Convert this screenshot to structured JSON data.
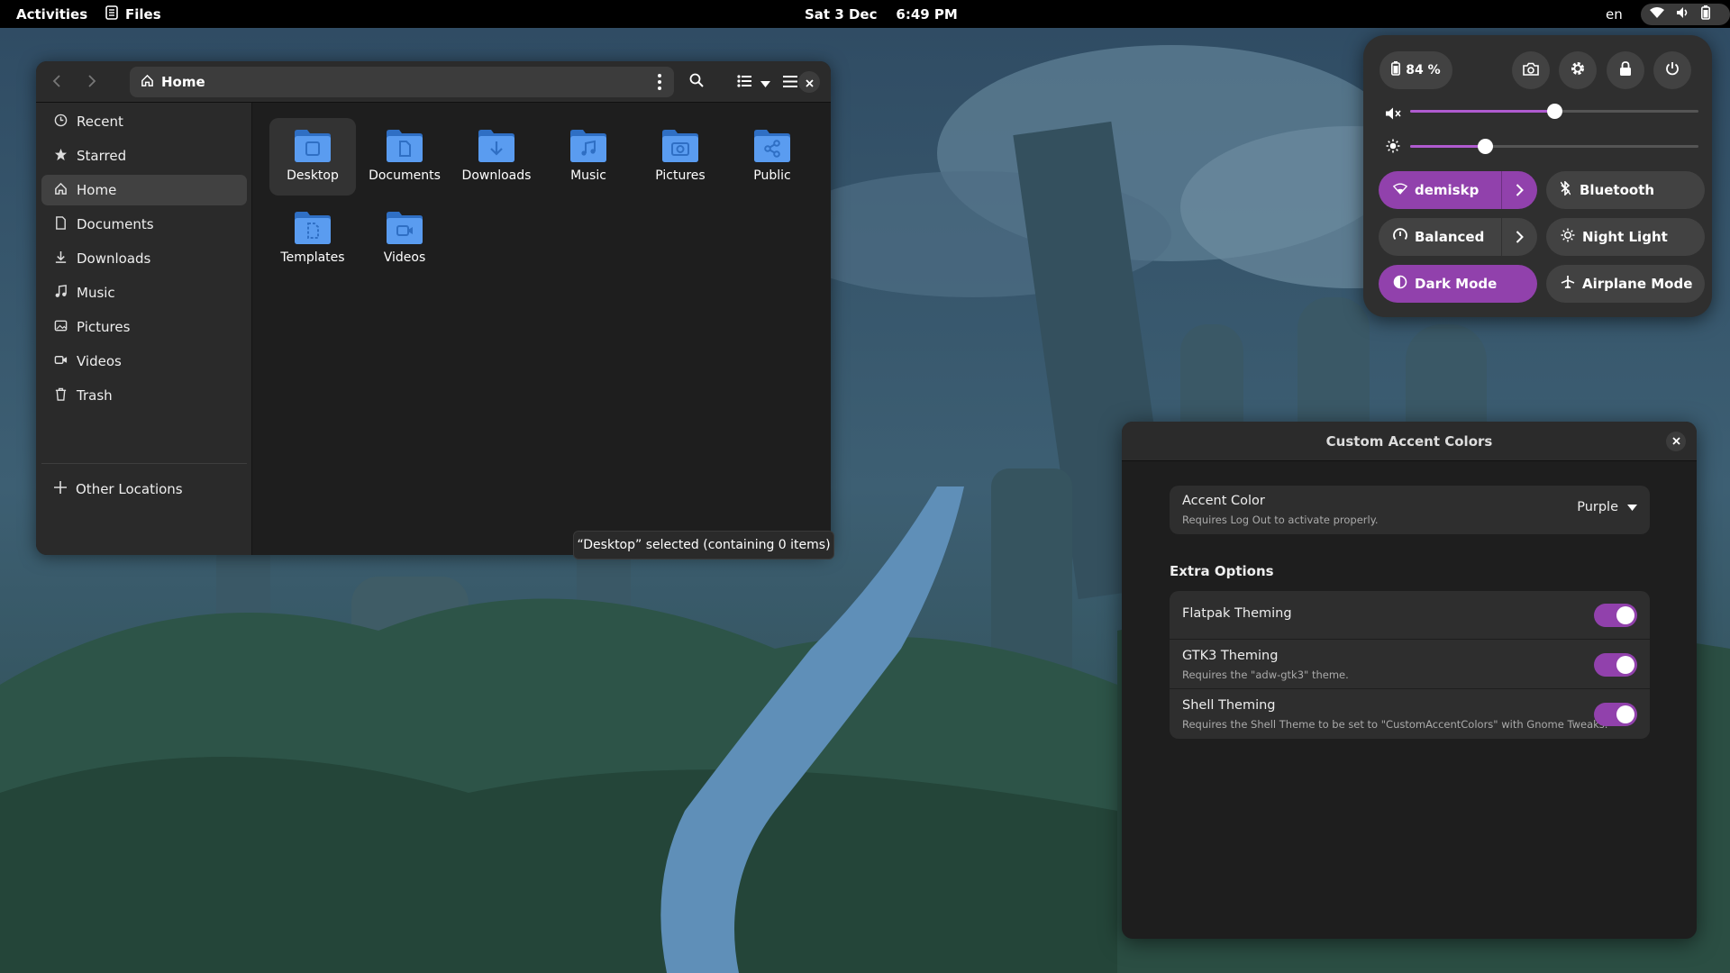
{
  "topbar": {
    "activities": "Activities",
    "app_name": "Files",
    "clock_date": "Sat 3 Dec",
    "clock_time": "6:49 PM",
    "language": "en"
  },
  "files_window": {
    "path_label": "Home",
    "sidebar": {
      "items": [
        {
          "label": "Recent",
          "icon": "clock-icon"
        },
        {
          "label": "Starred",
          "icon": "star-icon"
        },
        {
          "label": "Home",
          "icon": "home-icon",
          "selected": true
        },
        {
          "label": "Documents",
          "icon": "document-icon"
        },
        {
          "label": "Downloads",
          "icon": "download-icon"
        },
        {
          "label": "Music",
          "icon": "music-icon"
        },
        {
          "label": "Pictures",
          "icon": "picture-icon"
        },
        {
          "label": "Videos",
          "icon": "video-icon"
        },
        {
          "label": "Trash",
          "icon": "trash-icon"
        }
      ],
      "other_locations": "Other Locations"
    },
    "folders": [
      {
        "label": "Desktop",
        "icon": "desktop-icon",
        "selected": true
      },
      {
        "label": "Documents",
        "icon": "document-icon"
      },
      {
        "label": "Downloads",
        "icon": "download-icon"
      },
      {
        "label": "Music",
        "icon": "music-icon"
      },
      {
        "label": "Pictures",
        "icon": "camera-icon"
      },
      {
        "label": "Public",
        "icon": "share-icon"
      },
      {
        "label": "Templates",
        "icon": "template-icon"
      },
      {
        "label": "Videos",
        "icon": "video-icon"
      }
    ],
    "status": "“Desktop” selected  (containing 0 items)"
  },
  "quick_settings": {
    "battery": "84 %",
    "volume_level": 0.5,
    "brightness_level": 0.26,
    "toggles": [
      {
        "label": "demiskp",
        "icon": "wifi-icon",
        "active": true,
        "has_arrow": true
      },
      {
        "label": "Bluetooth",
        "icon": "bluetooth-icon",
        "active": false,
        "has_arrow": false
      },
      {
        "label": "Balanced",
        "icon": "power-profile-icon",
        "active": false,
        "has_arrow": true
      },
      {
        "label": "Night Light",
        "icon": "night-light-icon",
        "active": false,
        "has_arrow": false
      },
      {
        "label": "Dark Mode",
        "icon": "dark-mode-icon",
        "active": true,
        "has_arrow": false
      },
      {
        "label": "Airplane Mode",
        "icon": "airplane-icon",
        "active": false,
        "has_arrow": false
      }
    ]
  },
  "accent_dialog": {
    "title": "Custom Accent Colors",
    "accent_color": {
      "title": "Accent Color",
      "subtitle": "Requires Log Out to activate properly.",
      "value": "Purple"
    },
    "extra_options_heading": "Extra Options",
    "options": [
      {
        "title": "Flatpak Theming",
        "subtitle": "",
        "enabled": true
      },
      {
        "title": "GTK3 Theming",
        "subtitle": "Requires the \"adw-gtk3\" theme.",
        "enabled": true
      },
      {
        "title": "Shell Theming",
        "subtitle": "Requires the Shell Theme to be set to \"CustomAccentColors\" with Gnome Tweaks.",
        "enabled": true
      }
    ]
  },
  "colors": {
    "accent": "#9141ac",
    "folder_blue": "#438de6"
  }
}
